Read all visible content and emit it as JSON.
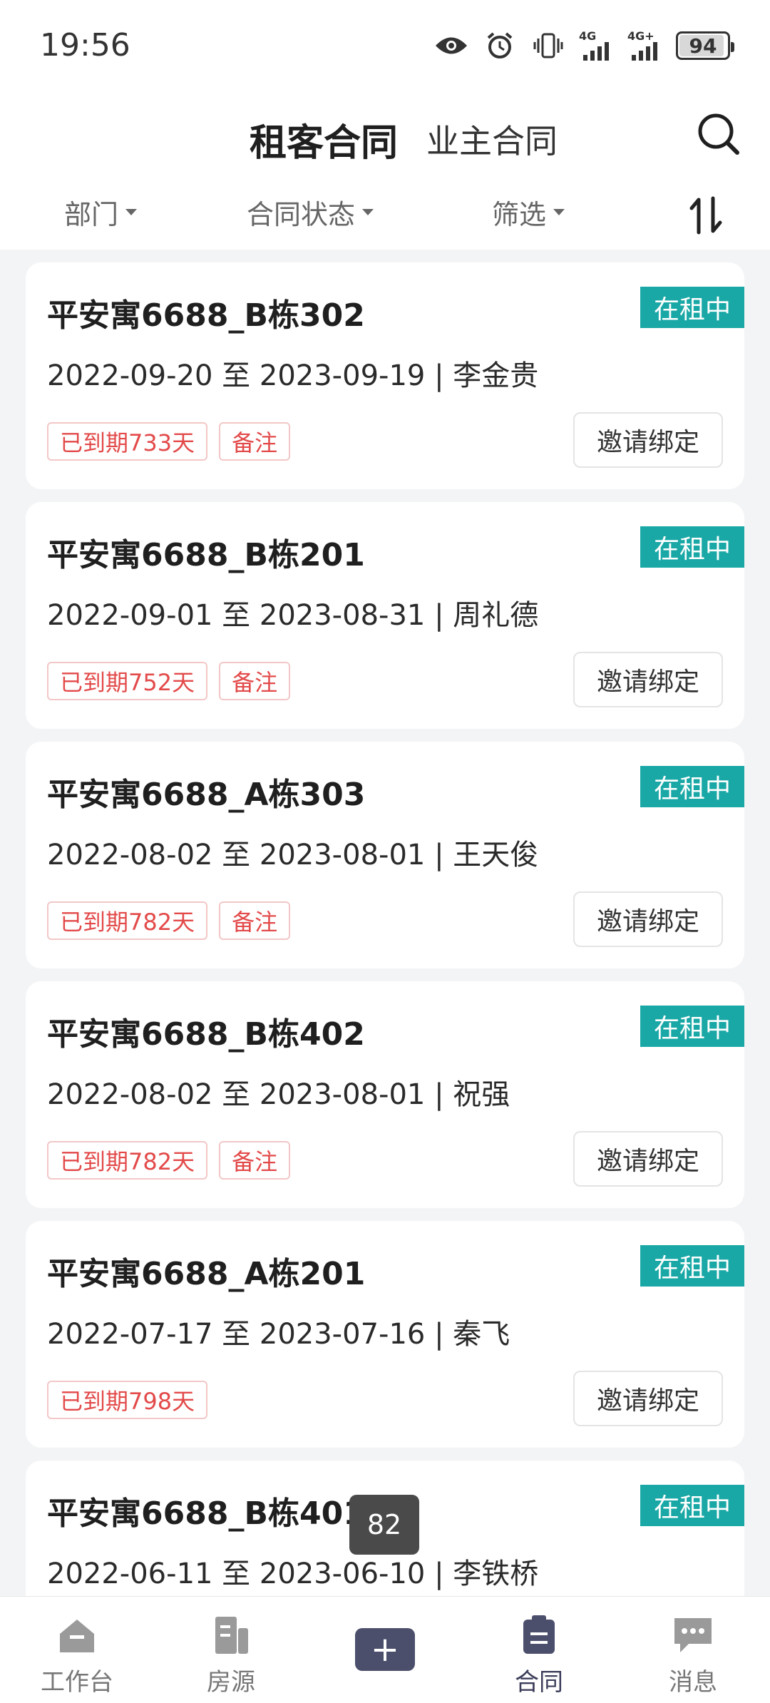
{
  "status_bar": {
    "time": "19:56",
    "network_1": "4G",
    "network_2": "4G+",
    "battery": "94",
    "battery_level": 0.94
  },
  "header": {
    "active_tab": "租客合同",
    "inactive_tab": "业主合同"
  },
  "filters": {
    "department": "部门",
    "contract_status": "合同状态",
    "filter": "筛选"
  },
  "contracts": [
    {
      "title": "平安寓6688_B栋302",
      "status": "在租中",
      "dates": "2022-09-20 至 2023-09-19 | 李金贵",
      "expired": "已到期733天",
      "remark": "备注",
      "action": "邀请绑定"
    },
    {
      "title": "平安寓6688_B栋201",
      "status": "在租中",
      "dates": "2022-09-01 至 2023-08-31 | 周礼德",
      "expired": "已到期752天",
      "remark": "备注",
      "action": "邀请绑定"
    },
    {
      "title": "平安寓6688_A栋303",
      "status": "在租中",
      "dates": "2022-08-02 至 2023-08-01 | 王天俊",
      "expired": "已到期782天",
      "remark": "备注",
      "action": "邀请绑定"
    },
    {
      "title": "平安寓6688_B栋402",
      "status": "在租中",
      "dates": "2022-08-02 至 2023-08-01 | 祝强",
      "expired": "已到期782天",
      "remark": "备注",
      "action": "邀请绑定"
    },
    {
      "title": "平安寓6688_A栋201",
      "status": "在租中",
      "dates": "2022-07-17 至 2023-07-16 | 秦飞",
      "expired": "已到期798天",
      "remark": "",
      "action": "邀请绑定"
    },
    {
      "title": "平安寓6688_B栋401",
      "status": "在租中",
      "dates": "2022-06-11 至 2023-06-10 | 李铁桥",
      "expired": "",
      "remark": "",
      "action": ""
    }
  ],
  "page_indicator": "82",
  "bottom_nav": {
    "workbench": "工作台",
    "listings": "房源",
    "contracts": "合同",
    "messages": "消息",
    "add_symbol": "+"
  },
  "colors": {
    "accent_teal": "#19a8a6",
    "expired_red": "#e34a4a",
    "nav_active": "#3c3e5a"
  }
}
